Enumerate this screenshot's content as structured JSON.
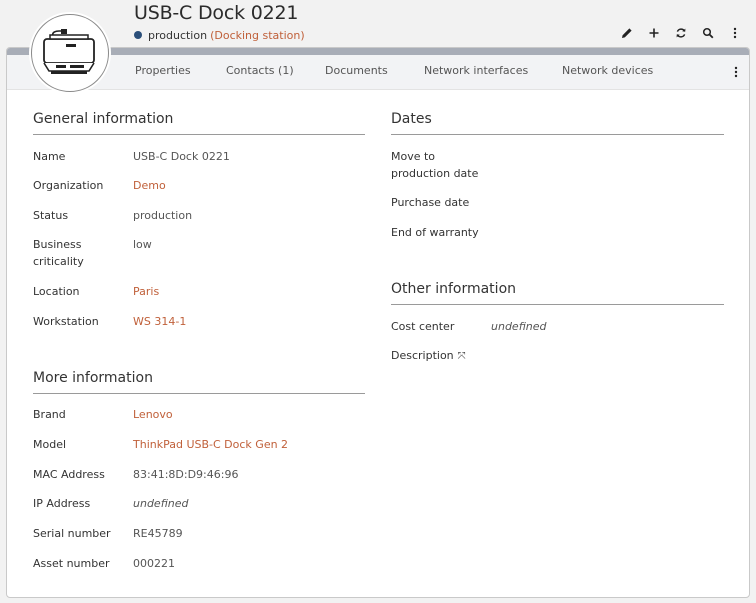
{
  "header": {
    "title": "USB-C Dock 0221",
    "status": "production",
    "status_color": "#2b4f7a",
    "class_name": "(Docking station)"
  },
  "toolbar": {
    "icons": [
      "pencil-icon",
      "plus-icon",
      "refresh-icon",
      "search-icon",
      "more-vertical-icon"
    ]
  },
  "tabs": [
    "Properties",
    "Contacts (1)",
    "Documents",
    "Network interfaces",
    "Network devices"
  ],
  "general": {
    "title": "General information",
    "fields": [
      {
        "label": "Name",
        "value": "USB-C Dock 0221"
      },
      {
        "label": "Organization",
        "value": "Demo"
      },
      {
        "label": "Status",
        "value": "production"
      },
      {
        "label": "Business criticality",
        "value": "low"
      },
      {
        "label": "Location",
        "value": "Paris"
      },
      {
        "label": "Workstation",
        "value": "WS 314-1"
      }
    ]
  },
  "more": {
    "title": "More information",
    "fields": [
      {
        "label": "Brand",
        "value": "Lenovo"
      },
      {
        "label": "Model",
        "value": "ThinkPad USB-C Dock Gen 2"
      },
      {
        "label": "MAC Address",
        "value": "83:41:8D:D9:46:96"
      },
      {
        "label": "IP Address",
        "value": "undefined"
      },
      {
        "label": "Serial number",
        "value": "RE45789"
      },
      {
        "label": "Asset number",
        "value": "000221"
      }
    ]
  },
  "dates": {
    "title": "Dates",
    "fields": [
      {
        "label": "Move to production date",
        "value": ""
      },
      {
        "label": "Purchase date",
        "value": ""
      },
      {
        "label": "End of warranty",
        "value": ""
      }
    ]
  },
  "other": {
    "title": "Other information",
    "fields": [
      {
        "label": "Cost center",
        "value": "undefined"
      },
      {
        "label": "Description",
        "value": "⤧"
      }
    ]
  }
}
